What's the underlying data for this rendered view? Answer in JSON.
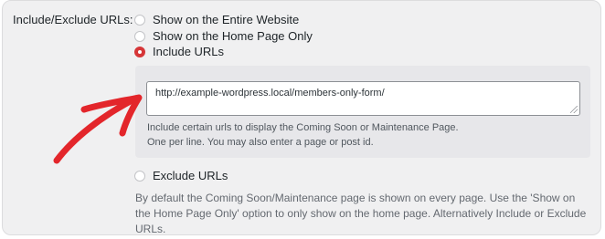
{
  "field": {
    "label": "Include/Exclude URLs:"
  },
  "options": [
    {
      "label": "Show on the Entire Website",
      "checked": false
    },
    {
      "label": "Show on the Home Page Only",
      "checked": false
    },
    {
      "label": "Include URLs",
      "checked": true
    },
    {
      "label": "Exclude URLs",
      "checked": false
    }
  ],
  "include_panel": {
    "url_value": "http://example-wordpress.local/members-only-form/",
    "help_line1": "Include certain urls to display the Coming Soon or Maintenance Page.",
    "help_line2": "One per line. You may also enter a page or post id."
  },
  "footnote": "By default the Coming Soon/Maintenance page is shown on every page. Use the 'Show on the Home Page Only' option to only show on the home page. Alternatively Include or Exclude URLs.",
  "colors": {
    "accent_red": "#d63638",
    "arrow_red": "#e3262b"
  },
  "icons": {
    "annotation": "arrow-annotation-icon"
  }
}
